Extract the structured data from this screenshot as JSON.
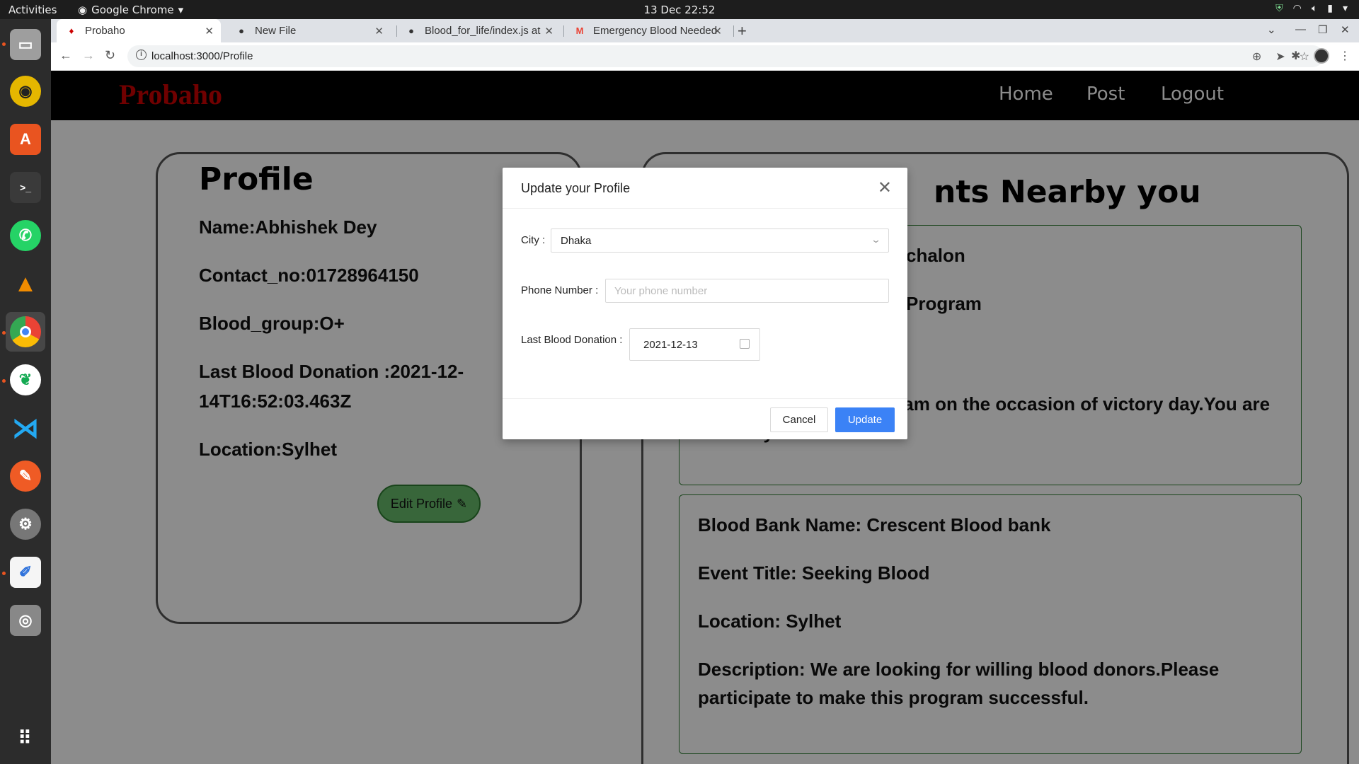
{
  "topbar": {
    "activities": "Activities",
    "app_name": "Google Chrome",
    "clock": "13 Dec  22:52"
  },
  "dock": {
    "items": [
      "files-icon",
      "rhythmbox-icon",
      "software-center-icon",
      "terminal-icon",
      "whatsapp-icon",
      "vlc-icon",
      "chrome-icon",
      "mongodb-compass-icon",
      "vscode-icon",
      "postman-icon",
      "settings-icon",
      "text-editor-icon",
      "disc-icon",
      "show-apps-icon"
    ]
  },
  "browser": {
    "tabs": [
      {
        "title": "Probaho",
        "icon": "probaho-favicon"
      },
      {
        "title": "New File",
        "icon": "github-icon"
      },
      {
        "title": "Blood_for_life/index.js at",
        "icon": "github-icon"
      },
      {
        "title": "Emergency Blood Needed",
        "icon": "gmail-icon"
      }
    ],
    "url": "localhost:3000/Profile"
  },
  "navbar": {
    "brand": "Probaho",
    "links": [
      "Home",
      "Post",
      "Logout"
    ],
    "brand_color": "#cc0000"
  },
  "profile": {
    "title": "Profile",
    "name": "Name:Abhishek Dey",
    "contact": "Contact_no:01728964150",
    "blood_group": "Blood_group:O+",
    "last_donation": "Last Blood Donation :2021-12-14T16:52:03.463Z",
    "location": "Location:Sylhet",
    "edit_button": "Edit Profile"
  },
  "events": {
    "title_visible": "nts Nearby you",
    "card1": {
      "line1": "chalon",
      "line2": "Program",
      "desc": "a Blood Donation program on the occasion of victory day.You are cordially invited."
    },
    "card2": {
      "bank": "Blood Bank Name: Crescent Blood bank",
      "title": "Event Title: Seeking Blood",
      "location": "Location: Sylhet",
      "desc": "Description: We are looking for willing blood donors.Please participate to make this program successful."
    }
  },
  "modal": {
    "title": "Update your Profile",
    "city_label": "City",
    "city_value": "Dhaka",
    "phone_label": "Phone Number",
    "phone_placeholder": "Your phone number",
    "donation_label": "Last Blood Donation",
    "donation_value": "2021-12-13",
    "cancel": "Cancel",
    "update": "Update",
    "accent": "#3b82f6"
  }
}
